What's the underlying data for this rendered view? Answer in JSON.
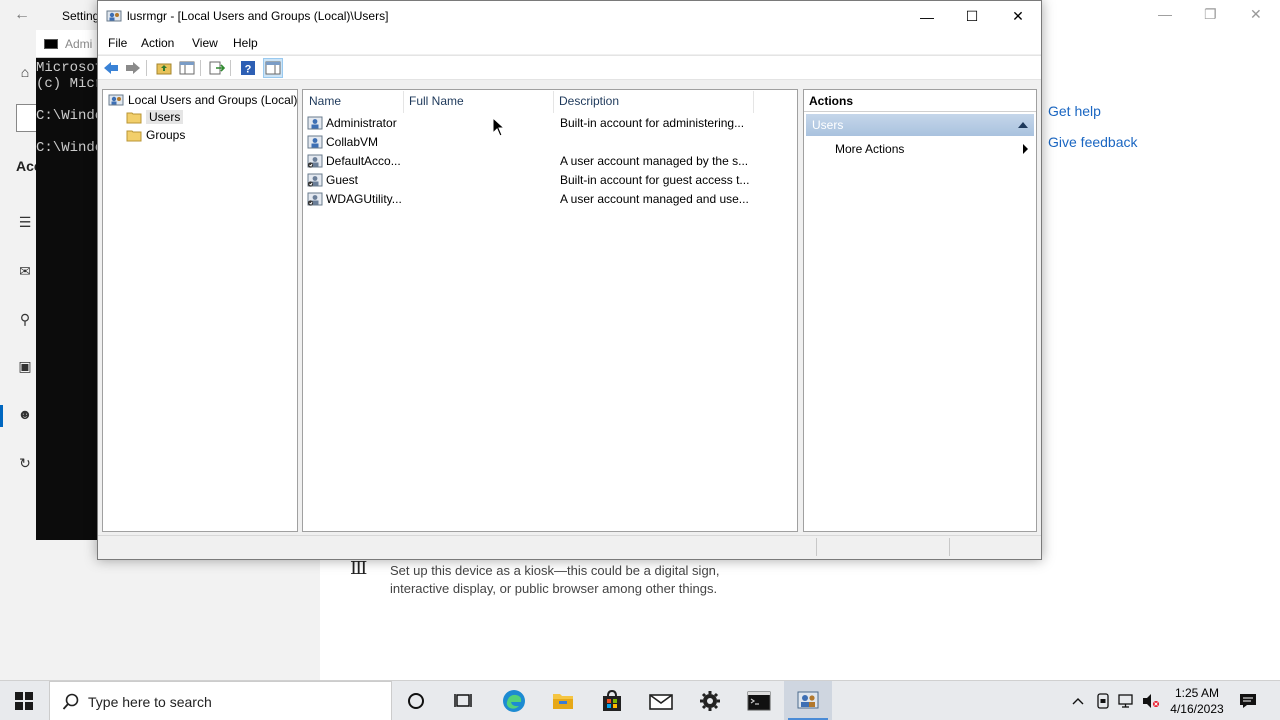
{
  "settings": {
    "title": "Settings",
    "links": {
      "get_help": "Get help",
      "give_feedback": "Give feedback"
    },
    "section_label": "Acc",
    "kiosk_text": "Set up this device as a kiosk—this could be a digital sign, interactive display, or public browser among other things."
  },
  "cmd": {
    "title": "Admi",
    "lines": "Microsoft\n(c) Micr\n\nC:\\Windo\n\nC:\\Windo"
  },
  "mmc": {
    "title": "lusrmgr - [Local Users and Groups (Local)\\Users]",
    "menu": {
      "file": "File",
      "action": "Action",
      "view": "View",
      "help": "Help"
    },
    "tree": {
      "root": "Local Users and Groups (Local)",
      "users": "Users",
      "groups": "Groups"
    },
    "columns": {
      "name": "Name",
      "full_name": "Full Name",
      "description": "Description"
    },
    "users": [
      {
        "name": "Administrator",
        "full_name": "",
        "description": "Built-in account for administering..."
      },
      {
        "name": "CollabVM",
        "full_name": "",
        "description": ""
      },
      {
        "name": "DefaultAcco...",
        "full_name": "",
        "description": "A user account managed by the s..."
      },
      {
        "name": "Guest",
        "full_name": "",
        "description": "Built-in account for guest access t..."
      },
      {
        "name": "WDAGUtility...",
        "full_name": "",
        "description": "A user account managed and use..."
      }
    ],
    "actions": {
      "header": "Actions",
      "group": "Users",
      "more_actions": "More Actions"
    }
  },
  "taskbar": {
    "search_placeholder": "Type here to search",
    "time": "1:25 AM",
    "date": "4/16/2023"
  },
  "colors": {
    "accent": "#0067c0",
    "link": "#1a66c2",
    "action_group": "#a9c2de"
  }
}
